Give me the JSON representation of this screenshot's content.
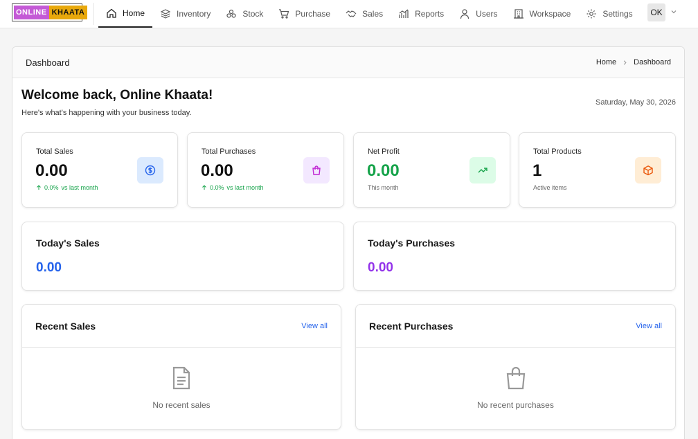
{
  "logo": {
    "part1": "ONLINE",
    "part2": "KHAATA"
  },
  "nav": {
    "items": [
      {
        "label": "Home",
        "icon": "home-icon"
      },
      {
        "label": "Inventory",
        "icon": "layers-icon"
      },
      {
        "label": "Stock",
        "icon": "boxes-icon"
      },
      {
        "label": "Purchase",
        "icon": "cart-icon"
      },
      {
        "label": "Sales",
        "icon": "handshake-icon"
      },
      {
        "label": "Reports",
        "icon": "chart-icon"
      },
      {
        "label": "Users",
        "icon": "user-icon"
      },
      {
        "label": "Workspace",
        "icon": "building-icon"
      },
      {
        "label": "Settings",
        "icon": "gear-icon"
      }
    ],
    "active": "Home",
    "user_initials": "OK"
  },
  "panel": {
    "title": "Dashboard",
    "breadcrumb": [
      "Home",
      "Dashboard"
    ]
  },
  "welcome": {
    "title": "Welcome back, Online Khaata!",
    "subtitle": "Here's what's happening with your business today.",
    "date": "Saturday, May 30, 2026"
  },
  "stats": [
    {
      "label": "Total Sales",
      "value": "0.00",
      "trend_pct": "0.0%",
      "trend_text": "vs last month",
      "icon": "dollar-icon",
      "accent": "#2563eb",
      "tile": "#dbeafe"
    },
    {
      "label": "Total Purchases",
      "value": "0.00",
      "trend_pct": "0.0%",
      "trend_text": "vs last month",
      "icon": "bag-icon",
      "accent": "#c026d3",
      "tile": "#f3e8ff"
    },
    {
      "label": "Net Profit",
      "value": "0.00",
      "sub": "This month",
      "icon": "trending-up-icon",
      "accent": "#16a34a",
      "tile": "#dcfce7"
    },
    {
      "label": "Total Products",
      "value": "1",
      "sub": "Active items",
      "icon": "cube-icon",
      "accent": "#ea580c",
      "tile": "#ffedd5"
    }
  ],
  "today": {
    "sales": {
      "label": "Today's Sales",
      "value": "0.00",
      "color": "#2563eb"
    },
    "purchases": {
      "label": "Today's Purchases",
      "value": "0.00",
      "color": "#9333ea"
    }
  },
  "recent": {
    "sales": {
      "title": "Recent Sales",
      "view_all": "View all",
      "empty": "No recent sales",
      "icon": "document-icon"
    },
    "purchases": {
      "title": "Recent Purchases",
      "view_all": "View all",
      "empty": "No recent purchases",
      "icon": "shopping-bag-icon"
    }
  }
}
